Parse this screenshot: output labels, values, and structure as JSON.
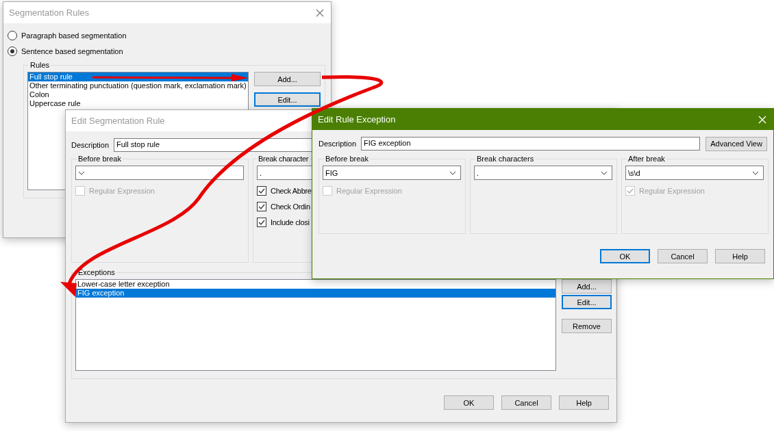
{
  "segmentation_rules_dialog": {
    "title": "Segmentation Rules",
    "modes": [
      {
        "label": "Paragraph based segmentation",
        "selected": false
      },
      {
        "label": "Sentence based segmentation",
        "selected": true
      }
    ],
    "rules": {
      "label": "Rules",
      "items": [
        {
          "label": "Full stop rule",
          "selected": true
        },
        {
          "label": "Other terminating punctuation (question mark, exclamation mark)",
          "selected": false
        },
        {
          "label": "Colon",
          "selected": false
        },
        {
          "label": "Uppercase rule",
          "selected": false
        }
      ],
      "buttons": [
        {
          "label": "Add...",
          "focused": false
        },
        {
          "label": "Edit...",
          "focused": true
        }
      ]
    }
  },
  "edit_segmentation_rule_dialog": {
    "title": "Edit Segmentation Rule",
    "description": {
      "label": "Description",
      "value": "Full stop rule"
    },
    "before_break": {
      "label": "Before break",
      "regex": {
        "label": "Regular Expression",
        "checked": false,
        "disabled": true
      }
    },
    "break_characters": {
      "label": "Break character",
      "value": ".",
      "options": [
        {
          "label": "Check Abbre",
          "checked": true
        },
        {
          "label": "Check Ordin",
          "checked": true
        },
        {
          "label": "Include closi",
          "checked": true
        }
      ]
    },
    "exceptions": {
      "label": "Exceptions",
      "items": [
        {
          "label": "Lower-case letter exception",
          "selected": false
        },
        {
          "label": "FIG exception",
          "selected": true
        }
      ],
      "buttons": [
        {
          "label": "Add...",
          "focused": false
        },
        {
          "label": "Edit...",
          "focused": true
        },
        {
          "label": "Remove",
          "focused": false
        }
      ]
    },
    "buttons": [
      {
        "label": "OK",
        "focused": false
      },
      {
        "label": "Cancel",
        "focused": false
      },
      {
        "label": "Help",
        "focused": false
      }
    ]
  },
  "edit_rule_exception_dialog": {
    "title": "Edit Rule Exception",
    "description": {
      "label": "Description",
      "value": "FIG exception"
    },
    "advanced_view_button": "Advanced View",
    "groups": [
      {
        "label": "Before break",
        "value": "FIG",
        "regex": {
          "label": "Regular Expression",
          "checked": false,
          "disabled": true
        }
      },
      {
        "label": "Break characters",
        "value": "."
      },
      {
        "label": "After break",
        "value": "\\s\\d",
        "regex": {
          "label": "Regular Expression",
          "checked": true,
          "disabled": true
        }
      }
    ],
    "buttons": [
      {
        "label": "OK",
        "focused": true
      },
      {
        "label": "Cancel",
        "focused": false
      },
      {
        "label": "Help",
        "focused": false
      }
    ]
  }
}
